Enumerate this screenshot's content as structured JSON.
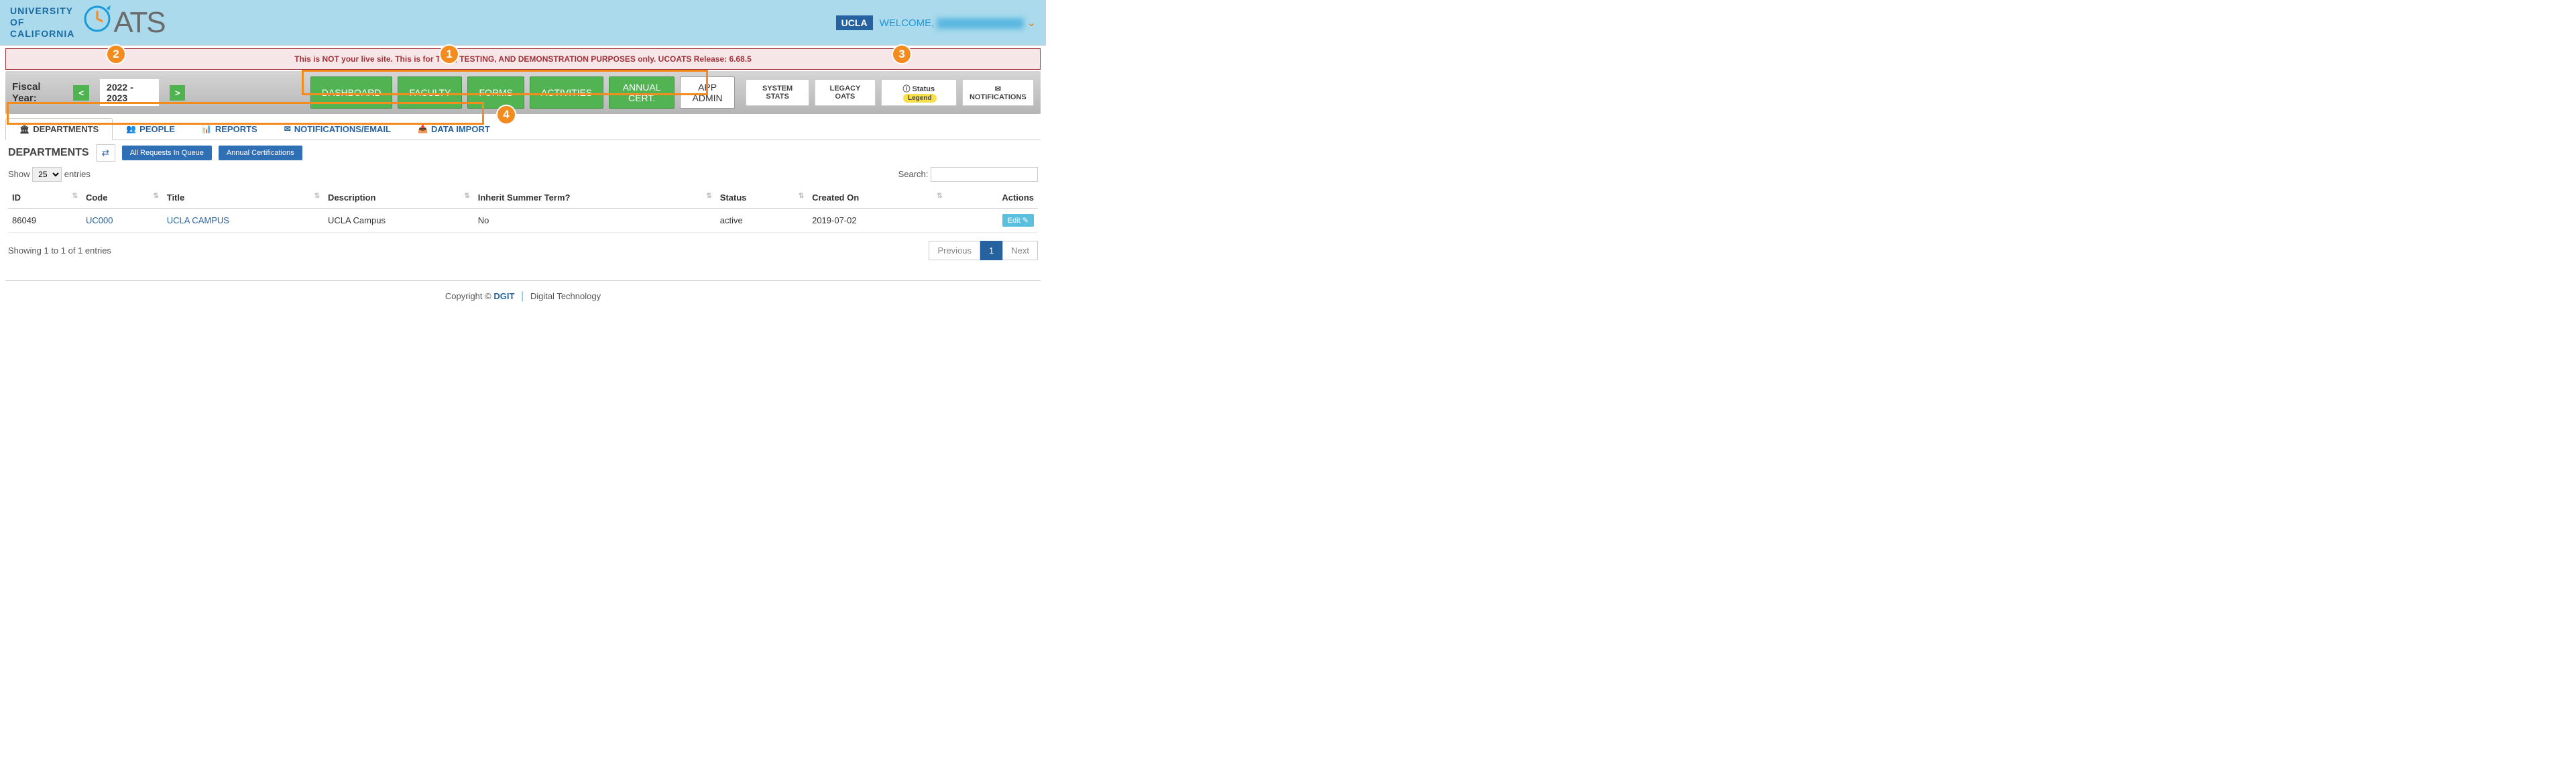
{
  "header": {
    "uc_line1": "UNIVERSITY",
    "uc_line2": "OF",
    "uc_line3": "CALIFORNIA",
    "oats_text": "ATS",
    "ucla_badge": "UCLA",
    "welcome": "WELCOME,"
  },
  "banner": {
    "text": "This is NOT your live site. This is for T             NG, TESTING, AND DEMONSTRATION PURPOSES only. UCOATS Release: 6.68.5"
  },
  "fiscal_year": {
    "label": "Fiscal Year:",
    "prev": "<",
    "value": "2022 - 2023",
    "next": ">"
  },
  "main_nav": [
    {
      "label": "DASHBOARD"
    },
    {
      "label": "FACULTY"
    },
    {
      "label": "FORMS"
    },
    {
      "label": "ACTIVITIES"
    },
    {
      "label": "ANNUAL CERT."
    },
    {
      "label": "APP ADMIN"
    }
  ],
  "right_btns": {
    "system_stats": "SYSTEM STATS",
    "legacy_oats": "LEGACY OATS",
    "status": "Status",
    "legend": "Legend",
    "notifications": "NOTIFICATIONS"
  },
  "sub_tabs": [
    {
      "label": "DEPARTMENTS",
      "icon": "🏛"
    },
    {
      "label": "PEOPLE",
      "icon": "👥"
    },
    {
      "label": "REPORTS",
      "icon": "📊"
    },
    {
      "label": "NOTIFICATIONS/EMAIL",
      "icon": "✉"
    },
    {
      "label": "DATA IMPORT",
      "icon": "📥"
    }
  ],
  "dept_section": {
    "title": "DEPARTMENTS",
    "all_requests": "All Requests In Queue",
    "annual_cert": "Annual Certifications"
  },
  "table": {
    "show": "Show",
    "entries": "entries",
    "entries_value": "25",
    "search_label": "Search:",
    "columns": [
      "ID",
      "Code",
      "Title",
      "Description",
      "Inherit Summer Term?",
      "Status",
      "Created On",
      "Actions"
    ],
    "rows": [
      {
        "id": "86049",
        "code": "UC000",
        "title": "UCLA CAMPUS",
        "description": "UCLA Campus",
        "inherit": "No",
        "status": "active",
        "created": "2019-07-02",
        "action": "Edit"
      }
    ],
    "info": "Showing 1 to 1 of 1 entries",
    "previous": "Previous",
    "page": "1",
    "next": "Next"
  },
  "footer": {
    "copyright": "Copyright ©",
    "dgit": "DGIT",
    "dt": "Digital Technology"
  },
  "callouts": [
    "1",
    "2",
    "3",
    "4"
  ]
}
